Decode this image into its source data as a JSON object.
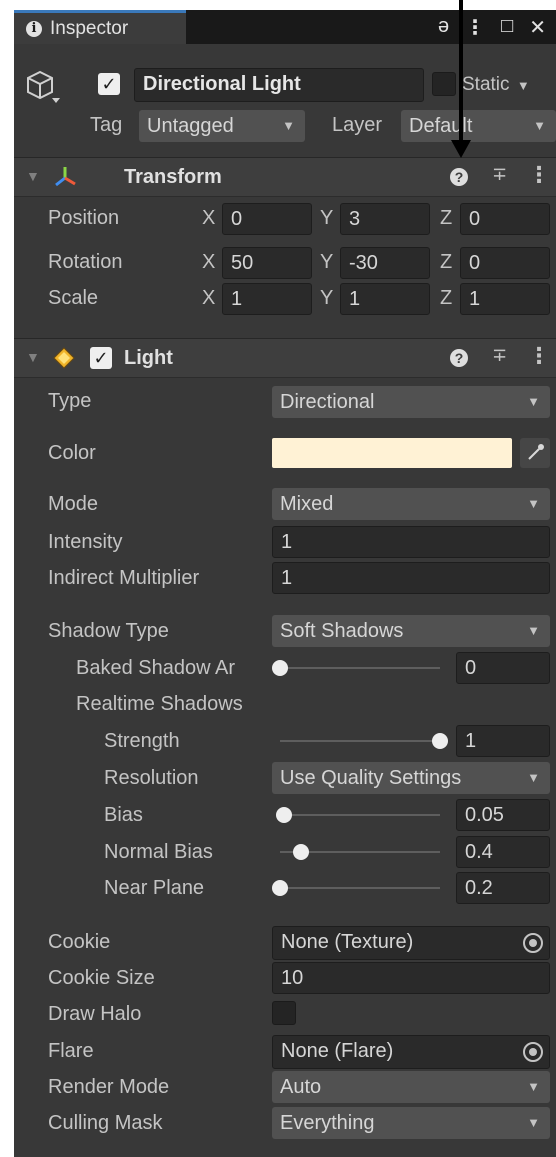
{
  "window": {
    "tab_label": "Inspector",
    "icons": [
      "lock-icon",
      "kebab-menu-icon",
      "maximize-icon",
      "close-icon"
    ],
    "accent": "#3a79bb"
  },
  "header": {
    "active": true,
    "object_name": "Directional Light",
    "static_checked": false,
    "static_label": "Static",
    "tag_label": "Tag",
    "tag_value": "Untagged",
    "layer_label": "Layer",
    "layer_value": "Default"
  },
  "transform": {
    "title": "Transform",
    "rows": [
      {
        "label": "Position",
        "x": "0",
        "y": "3",
        "z": "0"
      },
      {
        "label": "Rotation",
        "x": "50",
        "y": "-30",
        "z": "0"
      },
      {
        "label": "Scale",
        "x": "1",
        "y": "1",
        "z": "1"
      }
    ],
    "axis_labels": {
      "x": "X",
      "y": "Y",
      "z": "Z"
    }
  },
  "light": {
    "title": "Light",
    "enabled": true,
    "type_label": "Type",
    "type_value": "Directional",
    "color_label": "Color",
    "color_value": "#fff2d5",
    "mode_label": "Mode",
    "mode_value": "Mixed",
    "intensity_label": "Intensity",
    "intensity_value": "1",
    "indirect_label": "Indirect Multiplier",
    "indirect_value": "1",
    "shadow_type_label": "Shadow Type",
    "shadow_type_value": "Soft Shadows",
    "baked_angle_label": "Baked Shadow Ar",
    "baked_angle_value": "0",
    "baked_angle_fraction": 0.0,
    "realtime_label": "Realtime Shadows",
    "strength_label": "Strength",
    "strength_value": "1",
    "strength_fraction": 1.0,
    "resolution_label": "Resolution",
    "resolution_value": "Use Quality Settings",
    "bias_label": "Bias",
    "bias_value": "0.05",
    "bias_fraction": 0.025,
    "normal_bias_label": "Normal Bias",
    "normal_bias_value": "0.4",
    "normal_bias_fraction": 0.13,
    "near_plane_label": "Near Plane",
    "near_plane_value": "0.2",
    "near_plane_fraction": 0.0,
    "cookie_label": "Cookie",
    "cookie_value": "None (Texture)",
    "cookie_size_label": "Cookie Size",
    "cookie_size_value": "10",
    "draw_halo_label": "Draw Halo",
    "draw_halo_checked": false,
    "flare_label": "Flare",
    "flare_value": "None (Flare)",
    "render_mode_label": "Render Mode",
    "render_mode_value": "Auto",
    "culling_mask_label": "Culling Mask",
    "culling_mask_value": "Everything"
  }
}
